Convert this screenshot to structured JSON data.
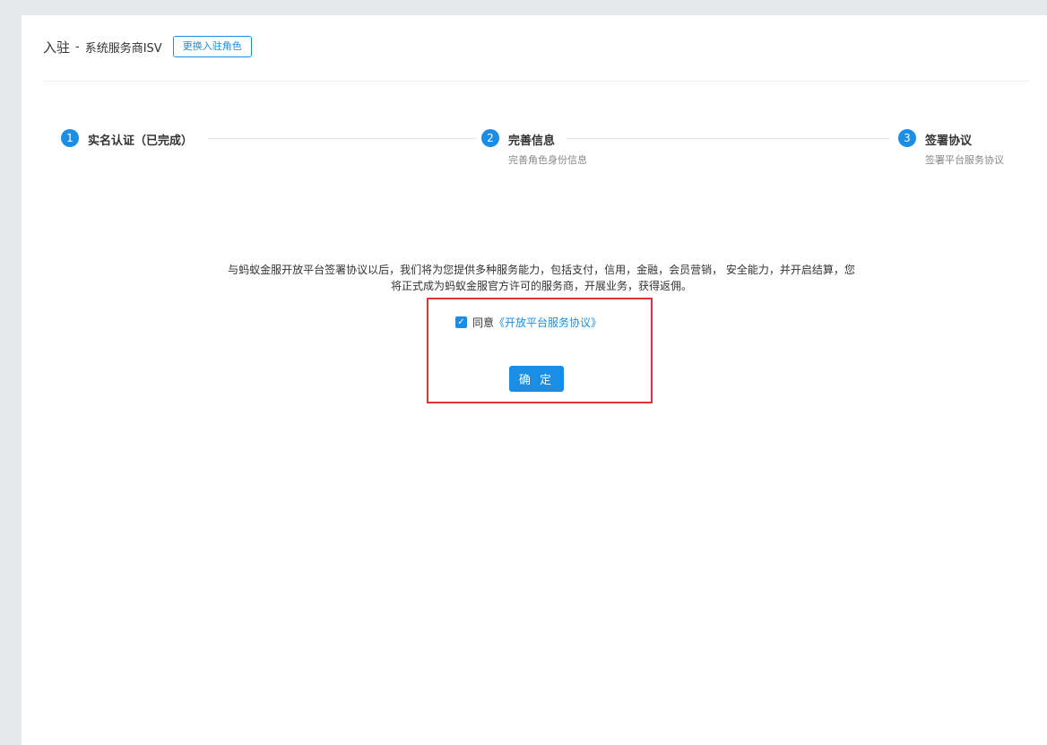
{
  "header": {
    "title": "入驻",
    "separator": "-",
    "role": "系统服务商ISV",
    "change_role_label": "更换入驻角色"
  },
  "steps": [
    {
      "number": "1",
      "title": "实名认证（已完成）",
      "desc": ""
    },
    {
      "number": "2",
      "title": "完善信息",
      "desc": "完善角色身份信息"
    },
    {
      "number": "3",
      "title": "签署协议",
      "desc": "签署平台服务协议"
    }
  ],
  "main": {
    "intro": "与蚂蚁金服开放平台签署协议以后，我们将为您提供多种服务能力，包括支付，信用，金融，会员营销， 安全能力，并开启结算，您将正式成为蚂蚁金服官方许可的服务商，开展业务，获得返佣。",
    "agree_prefix": "同意",
    "agreement_link": "《开放平台服务协议》",
    "agree_checked": true,
    "confirm_label": "确 定"
  },
  "colors": {
    "accent": "#1a8ee6",
    "highlight_border": "#e0333a",
    "background": "#e5e7ea"
  }
}
